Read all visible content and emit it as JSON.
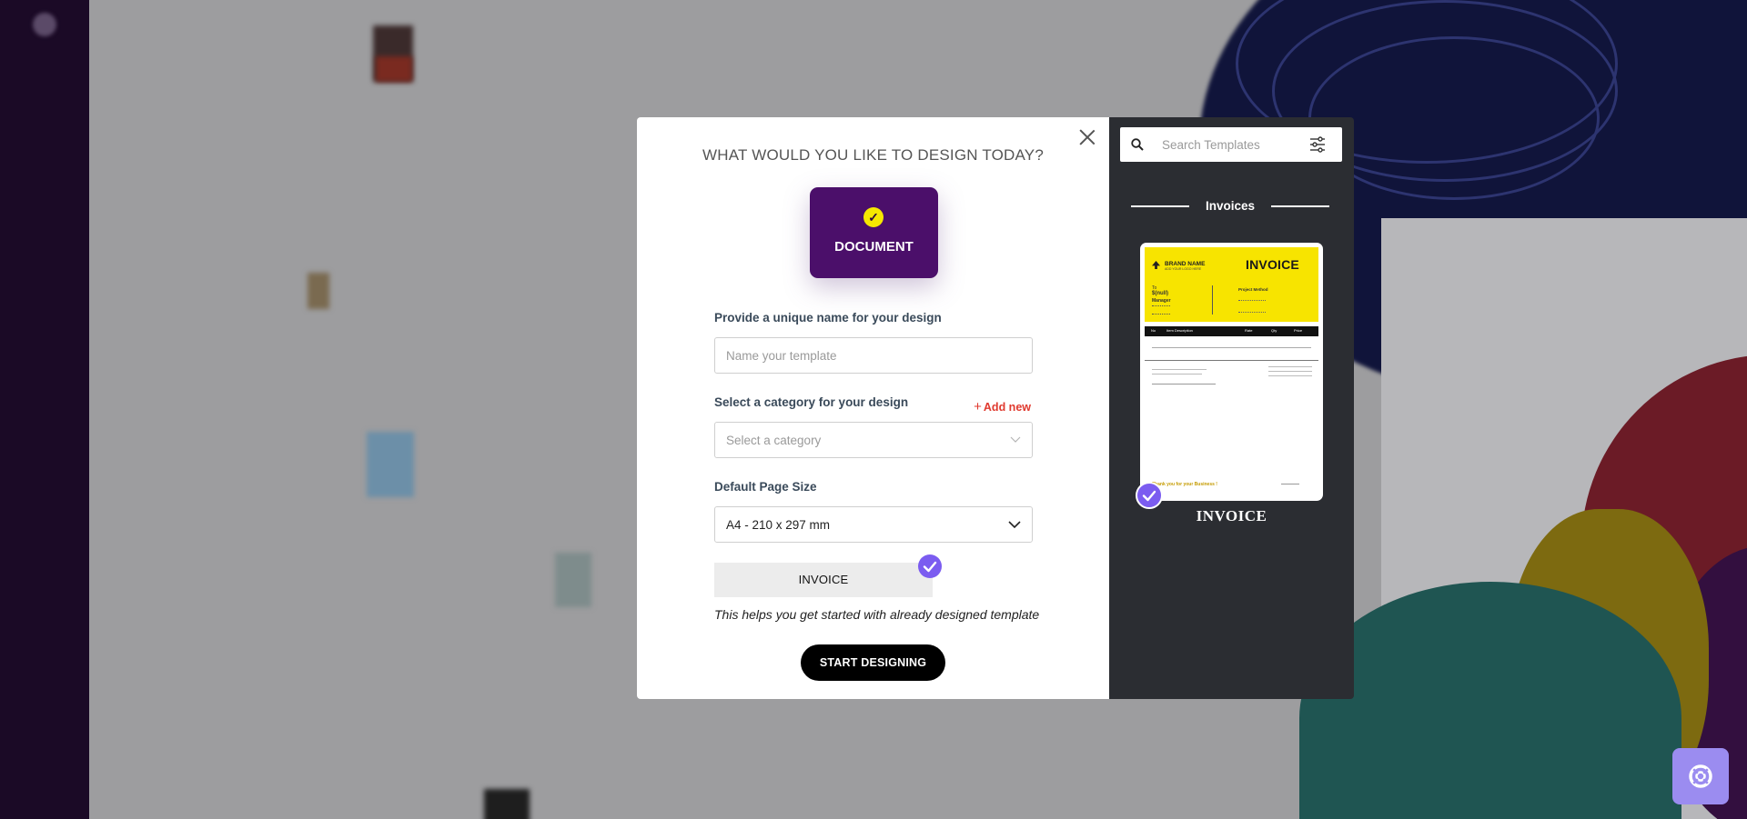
{
  "modal": {
    "title": "WHAT WOULD YOU LIKE TO DESIGN TODAY?",
    "design_type": {
      "label": "DOCUMENT",
      "selected": true
    },
    "name_field": {
      "label": "Provide a unique name for your design",
      "placeholder": "Name your template",
      "value": ""
    },
    "category_field": {
      "label": "Select a category for your design",
      "add_new_label": "Add new",
      "placeholder": "Select a category"
    },
    "page_size_field": {
      "label": "Default Page Size",
      "value": "A4 - 210 x 297 mm"
    },
    "selected_template": {
      "label": "INVOICE"
    },
    "helper_text": "This helps you get started with already designed template",
    "start_button_label": "START DESIGNING"
  },
  "template_panel": {
    "search_placeholder": "Search Templates",
    "category_heading": "Invoices",
    "templates": [
      {
        "name": "INVOICE",
        "selected": true
      }
    ]
  },
  "invoice_preview": {
    "title": "INVOICE",
    "brand": "BRAND NAME",
    "brand_sub": "ADD YOUR LOGO HERE",
    "to": "To",
    "client": "$(null)",
    "client_role": "Manager",
    "project": "Project Method",
    "table_headers": [
      "No",
      "Item Description",
      "Rate",
      "Qty",
      "Price"
    ],
    "thanks": "Thank you for your Business !"
  },
  "colors": {
    "accent_purple": "#4b0f6a",
    "check_purple": "#7b5cf0",
    "add_new_red": "#e03a2f",
    "panel_dark": "#2b2d32",
    "invoice_yellow": "#f7e400"
  },
  "icons": [
    "close-icon",
    "check-icon",
    "plus-icon",
    "chevron-down-icon",
    "search-icon",
    "filter-icon",
    "support-icon"
  ]
}
